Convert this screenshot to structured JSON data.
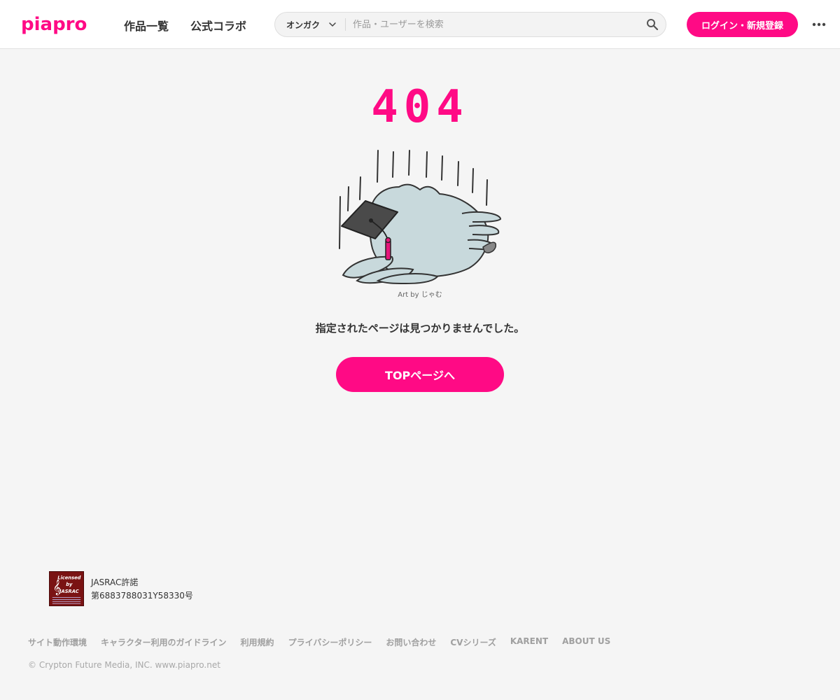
{
  "header": {
    "logo_text": "piapro",
    "nav": {
      "works": "作品一覧",
      "collab": "公式コラボ"
    },
    "search": {
      "category": "オンガク",
      "placeholder": "作品・ユーザーを検索"
    },
    "login_label": "ログイン・新規登録"
  },
  "main": {
    "error_code": "404",
    "art_credit": "Art by じゃむ",
    "message": "指定されたページは見つかりませんでした。",
    "top_button": "TOPページへ"
  },
  "footer": {
    "jasrac_badge": {
      "line1": "Licensed",
      "line2": "by",
      "line3": "JASRAC"
    },
    "jasrac_title": "JASRAC許諾",
    "jasrac_number": "第6883788031Y58330号",
    "links": [
      "サイト動作環境",
      "キャラクター利用のガイドライン",
      "利用規約",
      "プライバシーポリシー",
      "お問い合わせ",
      "CVシリーズ",
      "KARENT",
      "ABOUT US"
    ],
    "copyright": "© Crypton Future Media, INC. www.piapro.net"
  },
  "colors": {
    "accent": "#ff0a85",
    "background": "#f5f5f5"
  },
  "icons": [
    "chevron-down-icon",
    "search-icon",
    "more-dots-icon",
    "owl-illustration"
  ]
}
